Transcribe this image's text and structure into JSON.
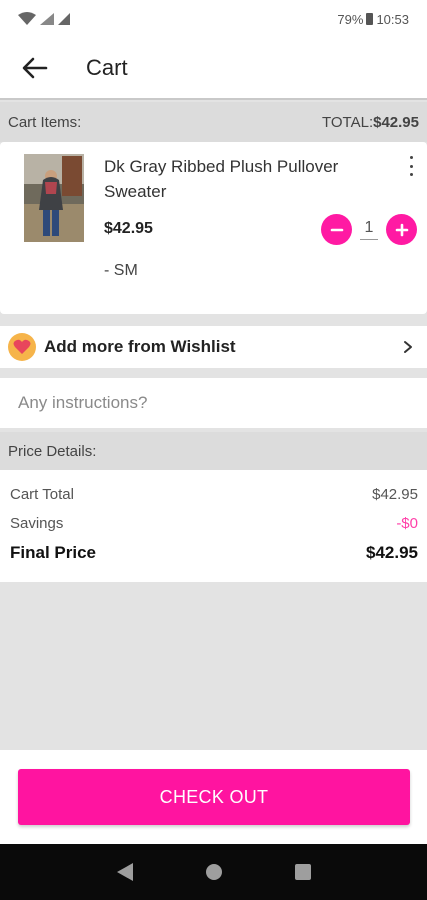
{
  "status": {
    "battery": "79%",
    "time": "10:53"
  },
  "header": {
    "title": "Cart"
  },
  "cart": {
    "items_label": "Cart Items:",
    "total_label": "TOTAL:",
    "total_value": "$42.95",
    "items": [
      {
        "name": "Dk Gray Ribbed Plush Pullover Sweater",
        "price": "$42.95",
        "quantity": "1",
        "size": "- SM"
      }
    ]
  },
  "wishlist": {
    "label": "Add more from Wishlist"
  },
  "instructions": {
    "placeholder": "Any instructions?"
  },
  "price_details": {
    "title": "Price Details:",
    "cart_total_label": "Cart Total",
    "cart_total_value": "$42.95",
    "savings_label": "Savings",
    "savings_value": "-$0",
    "final_label": "Final Price",
    "final_value": "$42.95"
  },
  "checkout": {
    "label": "CHECK OUT"
  },
  "colors": {
    "accent": "#ff14a0",
    "savings": "#ff3fa8",
    "heart_badge": "#f6b44a"
  },
  "icons": [
    "wifi-icon",
    "signal-icon",
    "battery-icon",
    "back-arrow-icon",
    "more-vert-icon",
    "minus-icon",
    "plus-icon",
    "heart-icon",
    "chevron-right-icon",
    "nav-back-icon",
    "nav-home-icon",
    "nav-recents-icon"
  ]
}
